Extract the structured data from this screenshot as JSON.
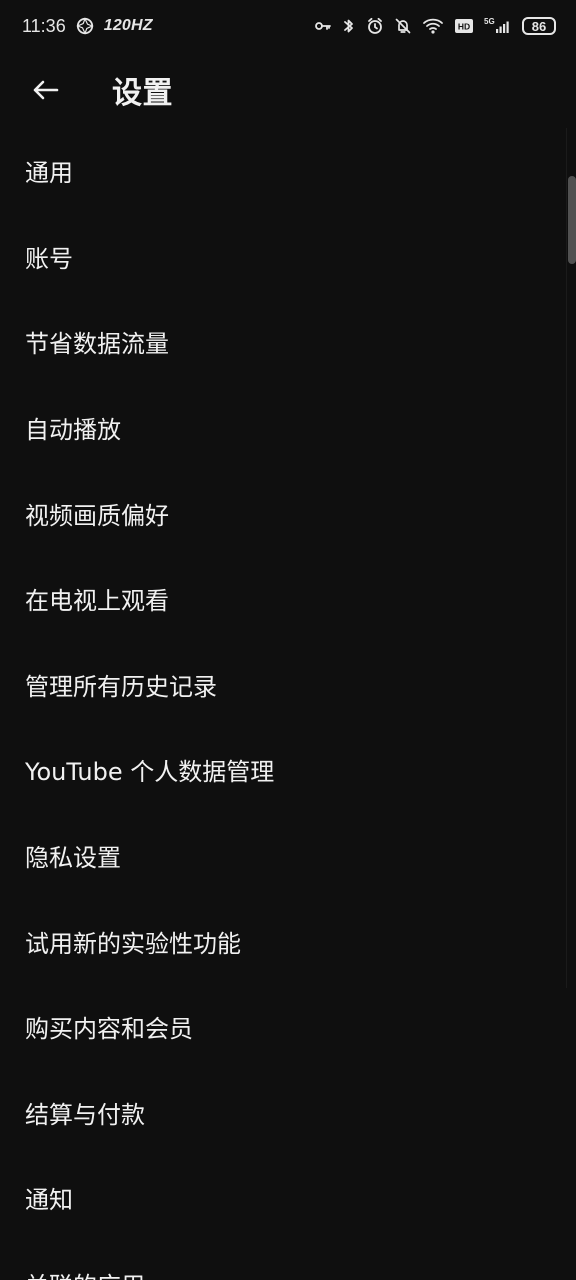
{
  "status_bar": {
    "time": "11:36",
    "refresh_rate": "120HZ",
    "network": "5G",
    "battery": "86",
    "hd_label": "HD"
  },
  "header": {
    "title": "设置",
    "back_icon": "arrow-left-icon"
  },
  "settings": {
    "items": [
      {
        "label": "通用"
      },
      {
        "label": "账号"
      },
      {
        "label": "节省数据流量"
      },
      {
        "label": "自动播放"
      },
      {
        "label": "视频画质偏好"
      },
      {
        "label": "在电视上观看"
      },
      {
        "label": "管理所有历史记录"
      },
      {
        "label": "YouTube 个人数据管理"
      },
      {
        "label": "隐私设置"
      },
      {
        "label": "试用新的实验性功能"
      },
      {
        "label": "购买内容和会员"
      },
      {
        "label": "结算与付款"
      },
      {
        "label": "通知"
      },
      {
        "label": "关联的应用"
      }
    ]
  },
  "colors": {
    "background": "#0f0f0f",
    "text": "#f1f1f1",
    "status_text": "#e6e6e6"
  }
}
